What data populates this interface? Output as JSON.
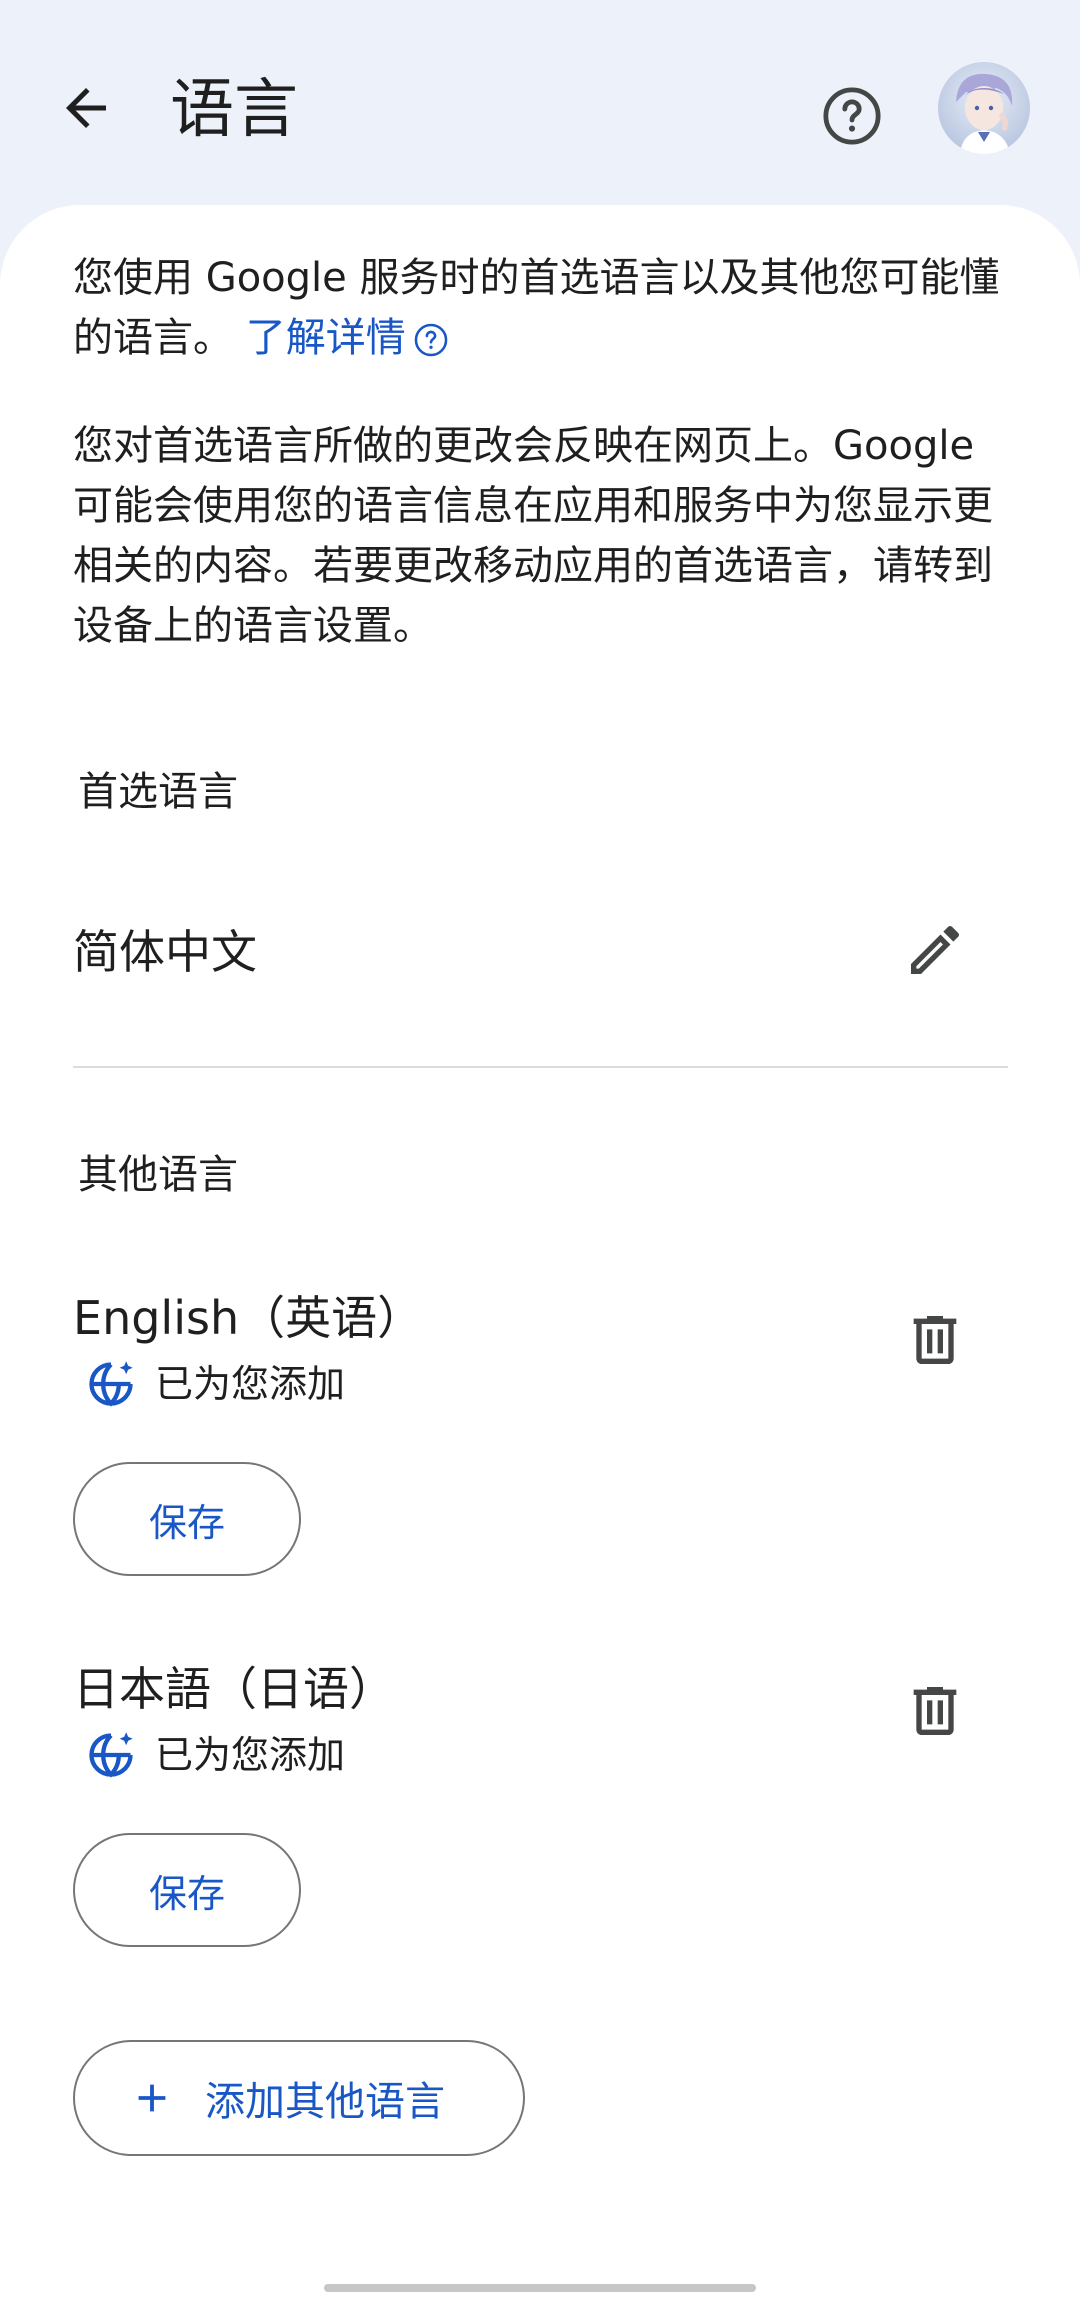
{
  "header": {
    "title": "语言",
    "back_icon": "arrow-left-icon",
    "help_icon": "help-circle-icon",
    "avatar": "avatar"
  },
  "intro": {
    "text": "您使用 Google 服务时的首选语言以及其他您可能懂的语言。",
    "learn_more": "了解详情"
  },
  "description": "您对首选语言所做的更改会反映在网页上。Google 可能会使用您的语言信息在应用和服务中为您显示更相关的内容。若要更改移动应用的首选语言，请转到设备上的语言设置。",
  "preferred": {
    "label": "首选语言",
    "language": "简体中文",
    "edit_icon": "pencil-icon"
  },
  "other": {
    "label": "其他语言",
    "items": [
      {
        "name": "English（英语）",
        "added_text": "已为您添加",
        "save_label": "保存"
      },
      {
        "name": "日本語（日语）",
        "added_text": "已为您添加",
        "save_label": "保存"
      }
    ]
  },
  "add_button": {
    "label": "添加其他语言",
    "icon": "plus-icon"
  },
  "colors": {
    "accent": "#1a57c6",
    "background": "#edf2fa",
    "surface": "#ffffff"
  }
}
